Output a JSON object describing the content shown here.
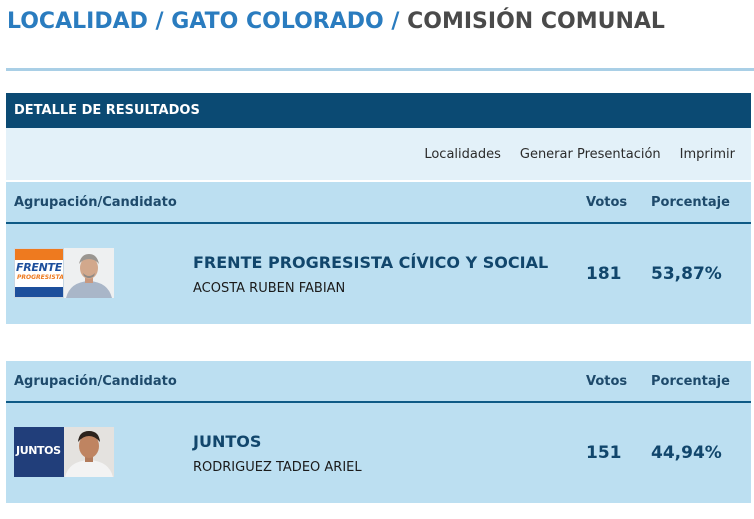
{
  "breadcrumb": {
    "level1": "LOCALIDAD",
    "level2": "GATO COLORADO",
    "current": "COMISIÓN COMUNAL",
    "separator": "/"
  },
  "results": {
    "title": "DETALLE DE RESULTADOS",
    "actions": {
      "localidades": "Localidades",
      "presentacion": "Generar Presentación",
      "imprimir": "Imprimir"
    },
    "columns": {
      "candidate": "Agrupación/Candidato",
      "votes": "Votos",
      "percent": "Porcentaje"
    },
    "rows": [
      {
        "party": "FRENTE PROGRESISTA CÍVICO Y SOCIAL",
        "candidate": "ACOSTA RUBEN FABIAN",
        "votes": "181",
        "percent": "53,87%",
        "logo_text_1": "FRENTE",
        "logo_text_2": "PROGRESISTA"
      },
      {
        "party": "JUNTOS",
        "candidate": "RODRIGUEZ TADEO ARIEL",
        "votes": "151",
        "percent": "44,94%",
        "logo_text_1": "JUNTOS"
      }
    ]
  },
  "colors": {
    "link_blue": "#2a7cbf",
    "header_navy": "#0b4a73",
    "row_bg": "#bcdff1",
    "toolbar_bg": "#e3f1f9"
  }
}
